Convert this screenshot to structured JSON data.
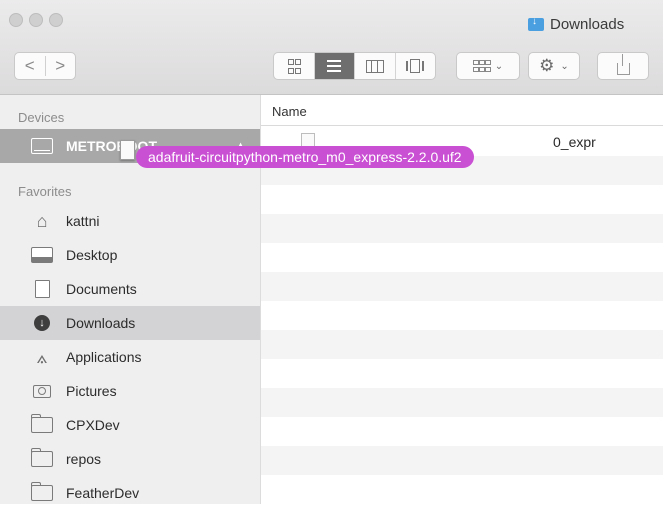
{
  "window": {
    "title": "Downloads"
  },
  "toolbar": {
    "back": "<",
    "forward": ">",
    "action_glyph": "⚙",
    "caret": "⌄"
  },
  "sidebar": {
    "devices_heading": "Devices",
    "device": {
      "label": "METROBOOT",
      "eject": "▲",
      "icon": "drive-icon"
    },
    "favorites_heading": "Favorites",
    "favorites": [
      {
        "label": "kattni",
        "icon": "home-icon"
      },
      {
        "label": "Desktop",
        "icon": "desktop-icon"
      },
      {
        "label": "Documents",
        "icon": "documents-icon"
      },
      {
        "label": "Downloads",
        "icon": "downloads-icon",
        "selected": true
      },
      {
        "label": "Applications",
        "icon": "applications-icon"
      },
      {
        "label": "Pictures",
        "icon": "pictures-icon"
      },
      {
        "label": "CPXDev",
        "icon": "folder-icon"
      },
      {
        "label": "repos",
        "icon": "folder-icon"
      },
      {
        "label": "FeatherDev",
        "icon": "folder-icon"
      }
    ]
  },
  "content": {
    "column_name": "Name",
    "files": [
      {
        "name": "adafruit-circuitpython-metro_m0_express-2.2.0.uf2",
        "visible_tail": "0_expr"
      }
    ]
  },
  "drag": {
    "label": "adafruit-circuitpython-metro_m0_express-2.2.0.uf2",
    "color": "#c94fd3"
  },
  "colors": {
    "sidebar_bg": "#efeff0",
    "selection": "#d3d2d4",
    "device_highlight": "#a8a8a8"
  }
}
